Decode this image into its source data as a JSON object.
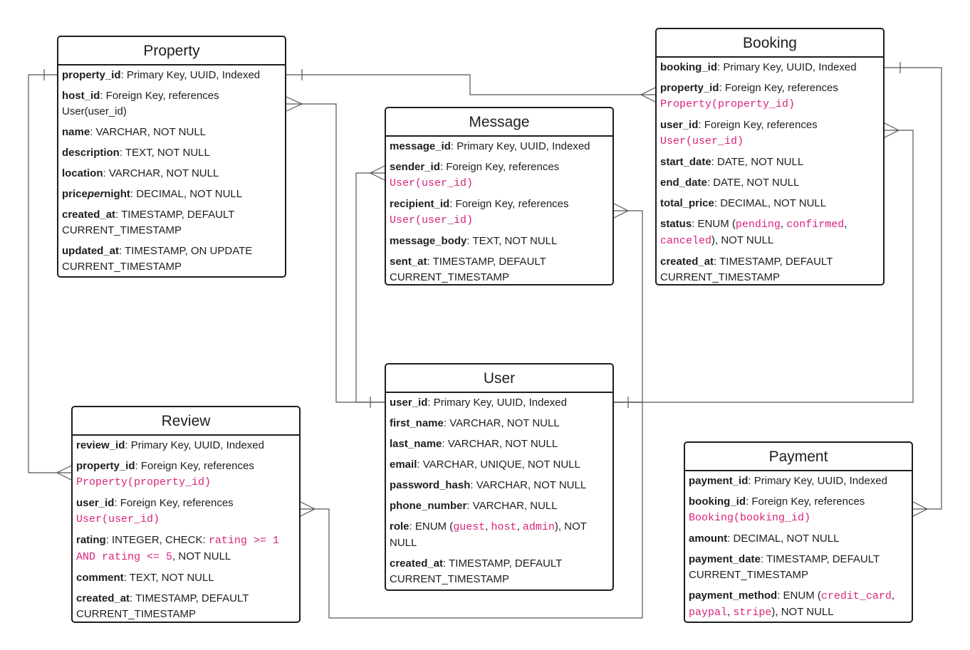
{
  "property": {
    "title": "Property",
    "f_property_id": {
      "name": "property_id",
      "desc": ": Primary Key, UUID, Indexed"
    },
    "f_host_id": {
      "name": "host_id",
      "desc": ": Foreign Key, references User(user_id)"
    },
    "f_name": {
      "name": "name",
      "desc": ": VARCHAR, NOT NULL"
    },
    "f_description": {
      "name": "description",
      "desc": ": TEXT, NOT NULL"
    },
    "f_location": {
      "name": "location",
      "desc": ": VARCHAR, NOT NULL"
    },
    "f_price": {
      "name_a": "price",
      "name_b": "per",
      "name_c": "night",
      "desc": ": DECIMAL, NOT NULL"
    },
    "f_created_at": {
      "name": "created_at",
      "desc": ": TIMESTAMP, DEFAULT CURRENT_TIMESTAMP"
    },
    "f_updated_at": {
      "name": "updated_at",
      "desc": ": TIMESTAMP, ON UPDATE CURRENT_TIMESTAMP"
    }
  },
  "booking": {
    "title": "Booking",
    "f_booking_id": {
      "name": "booking_id",
      "desc": ": Primary Key, UUID, Indexed"
    },
    "f_property_id": {
      "name": "property_id",
      "desc": ": Foreign Key, references ",
      "ref": "Property(property_id)"
    },
    "f_user_id": {
      "name": "user_id",
      "desc": ": Foreign Key, references ",
      "ref": "User(user_id)"
    },
    "f_start_date": {
      "name": "start_date",
      "desc": ": DATE, NOT NULL"
    },
    "f_end_date": {
      "name": "end_date",
      "desc": ": DATE, NOT NULL"
    },
    "f_total_price": {
      "name": "total_price",
      "desc": ": DECIMAL, NOT NULL"
    },
    "f_status": {
      "name": "status",
      "desc_a": ": ENUM (",
      "v1": "pending",
      "sep1": ", ",
      "v2": "confirmed",
      "sep2": ", ",
      "v3": "canceled",
      "desc_b": "), NOT NULL"
    },
    "f_created_at": {
      "name": "created_at",
      "desc": ": TIMESTAMP, DEFAULT CURRENT_TIMESTAMP"
    }
  },
  "message": {
    "title": "Message",
    "f_message_id": {
      "name": "message_id",
      "desc": ": Primary Key, UUID, Indexed"
    },
    "f_sender_id": {
      "name": "sender_id",
      "desc": ": Foreign Key, references ",
      "ref": "User(user_id)"
    },
    "f_recipient_id": {
      "name": "recipient_id",
      "desc": ": Foreign Key, references ",
      "ref": "User(user_id)"
    },
    "f_message_body": {
      "name": "message_body",
      "desc": ": TEXT, NOT NULL"
    },
    "f_sent_at": {
      "name": "sent_at",
      "desc": ": TIMESTAMP, DEFAULT CURRENT_TIMESTAMP"
    }
  },
  "user": {
    "title": "User",
    "f_user_id": {
      "name": "user_id",
      "desc": ": Primary Key, UUID, Indexed"
    },
    "f_first_name": {
      "name": "first_name",
      "desc": ": VARCHAR, NOT NULL"
    },
    "f_last_name": {
      "name": "last_name",
      "desc": ": VARCHAR, NOT NULL"
    },
    "f_email": {
      "name": "email",
      "desc": ": VARCHAR, UNIQUE, NOT NULL"
    },
    "f_password_hash": {
      "name": "password_hash",
      "desc": ": VARCHAR, NOT NULL"
    },
    "f_phone_number": {
      "name": "phone_number",
      "desc": ": VARCHAR, NULL"
    },
    "f_role": {
      "name": "role",
      "desc_a": ": ENUM (",
      "v1": "guest",
      "sep1": ", ",
      "v2": "host",
      "sep2": ", ",
      "v3": "admin",
      "desc_b": "), NOT NULL"
    },
    "f_created_at": {
      "name": "created_at",
      "desc": ": TIMESTAMP, DEFAULT CURRENT_TIMESTAMP"
    }
  },
  "review": {
    "title": "Review",
    "f_review_id": {
      "name": "review_id",
      "desc": ": Primary Key, UUID, Indexed"
    },
    "f_property_id": {
      "name": "property_id",
      "desc": ": Foreign Key, references ",
      "ref": "Property(property_id)"
    },
    "f_user_id": {
      "name": "user_id",
      "desc": ": Foreign Key, references ",
      "ref": "User(user_id)"
    },
    "f_rating": {
      "name": "rating",
      "desc_a": ": INTEGER, CHECK: ",
      "check": "rating >= 1 AND rating <= 5",
      "desc_b": ", NOT NULL"
    },
    "f_comment": {
      "name": "comment",
      "desc": ": TEXT, NOT NULL"
    },
    "f_created_at": {
      "name": "created_at",
      "desc": ": TIMESTAMP, DEFAULT CURRENT_TIMESTAMP"
    }
  },
  "payment": {
    "title": "Payment",
    "f_payment_id": {
      "name": "payment_id",
      "desc": ": Primary Key, UUID, Indexed"
    },
    "f_booking_id": {
      "name": "booking_id",
      "desc": ": Foreign Key, references ",
      "ref": "Booking(booking_id)"
    },
    "f_amount": {
      "name": "amount",
      "desc": ": DECIMAL, NOT NULL"
    },
    "f_payment_date": {
      "name": "payment_date",
      "desc": ": TIMESTAMP, DEFAULT CURRENT_TIMESTAMP"
    },
    "f_payment_method": {
      "name": "payment_method",
      "desc_a": ": ENUM (",
      "v1": "credit_card",
      "sep1": ", ",
      "v2": "paypal",
      "sep2": ", ",
      "v3": "stripe",
      "desc_b": "), NOT NULL"
    }
  },
  "colors": {
    "line": "#1e1e1e",
    "reference": "#d9237b",
    "background": "#ffffff"
  }
}
